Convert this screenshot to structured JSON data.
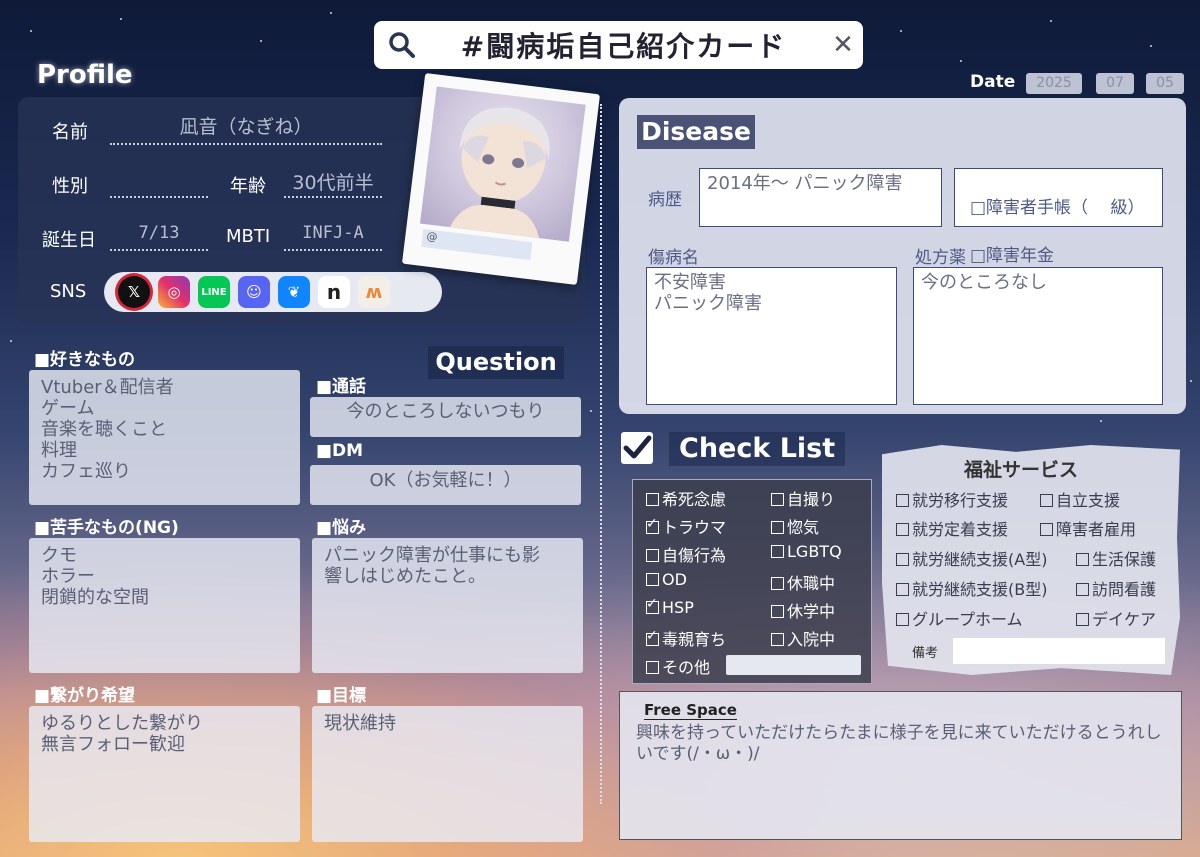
{
  "search": {
    "title": "#闘病垢自己紹介カード"
  },
  "date": {
    "label": "Date",
    "year": "2025",
    "month": "07",
    "day": "05"
  },
  "profile": {
    "heading": "Profile",
    "name_label": "名前",
    "name": "凪音（なぎね）",
    "gender_label": "性別",
    "gender": "",
    "age_label": "年齢",
    "age": "30代前半",
    "birthday_label": "誕生日",
    "birthday": "7/13",
    "mbti_label": "MBTI",
    "mbti": "INFJ-A",
    "sns_label": "SNS",
    "sns_icons": [
      "x-icon",
      "instagram-icon",
      "line-icon",
      "discord-icon",
      "bluesky-icon",
      "note-icon",
      "misskey-icon"
    ],
    "handle": "@"
  },
  "likes": {
    "label": "■好きなもの",
    "text": "Vtuber＆配信者\nゲーム\n音楽を聴くこと\n料理\nカフェ巡り"
  },
  "dislikes": {
    "label": "■苦手なもの(NG)",
    "text": "クモ\nホラー\n閉鎖的な空間"
  },
  "connect": {
    "label": "■繋がり希望",
    "text": "ゆるりとした繋がり\n無言フォロー歓迎"
  },
  "question": {
    "heading": "Question",
    "call_label": "■通話",
    "call": "今のところしないつもり",
    "dm_label": "■DM",
    "dm": "OK（お気軽に！）",
    "worry_label": "■悩み",
    "worry": "パニック障害が仕事にも影\n響しはじめたこと。",
    "goal_label": "■目標",
    "goal": "現状維持"
  },
  "disease": {
    "heading": "Disease",
    "history_label": "病歴",
    "history": "2014年〜 パニック障害",
    "handbook": "□障害者手帳（　 級）",
    "pension": "□障害年金",
    "diagnosis_label": "傷病名",
    "diagnosis": "不安障害\nパニック障害",
    "meds_label": "処方薬",
    "meds": "今のところなし"
  },
  "checklist": {
    "heading": "Check List",
    "items": [
      {
        "label": "希死念慮",
        "checked": false
      },
      {
        "label": "自撮り",
        "checked": false
      },
      {
        "label": "トラウマ",
        "checked": true
      },
      {
        "label": "惚気",
        "checked": false
      },
      {
        "label": "自傷行為",
        "checked": false
      },
      {
        "label": "LGBTQ",
        "checked": false
      },
      {
        "label": "OD",
        "checked": false
      },
      {
        "label": "休職中",
        "checked": false
      },
      {
        "label": "HSP",
        "checked": true
      },
      {
        "label": "休学中",
        "checked": false
      },
      {
        "label": "毒親育ち",
        "checked": true
      },
      {
        "label": "入院中",
        "checked": false
      },
      {
        "label": "その他",
        "checked": false
      }
    ]
  },
  "welfare": {
    "heading": "福祉サービス",
    "items": [
      "就労移行支援",
      "自立支援",
      "就労定着支援",
      "障害者雇用",
      "就労継続支援(A型)",
      "生活保護",
      "就労継続支援(B型)",
      "訪問看護",
      "グループホーム",
      "デイケア"
    ],
    "notes_label": "備考"
  },
  "free_space": {
    "heading": "Free Space",
    "text": "興味を持っていただけたらたまに様子を見に来ていただけるとうれしいです(/・ω・)/"
  }
}
